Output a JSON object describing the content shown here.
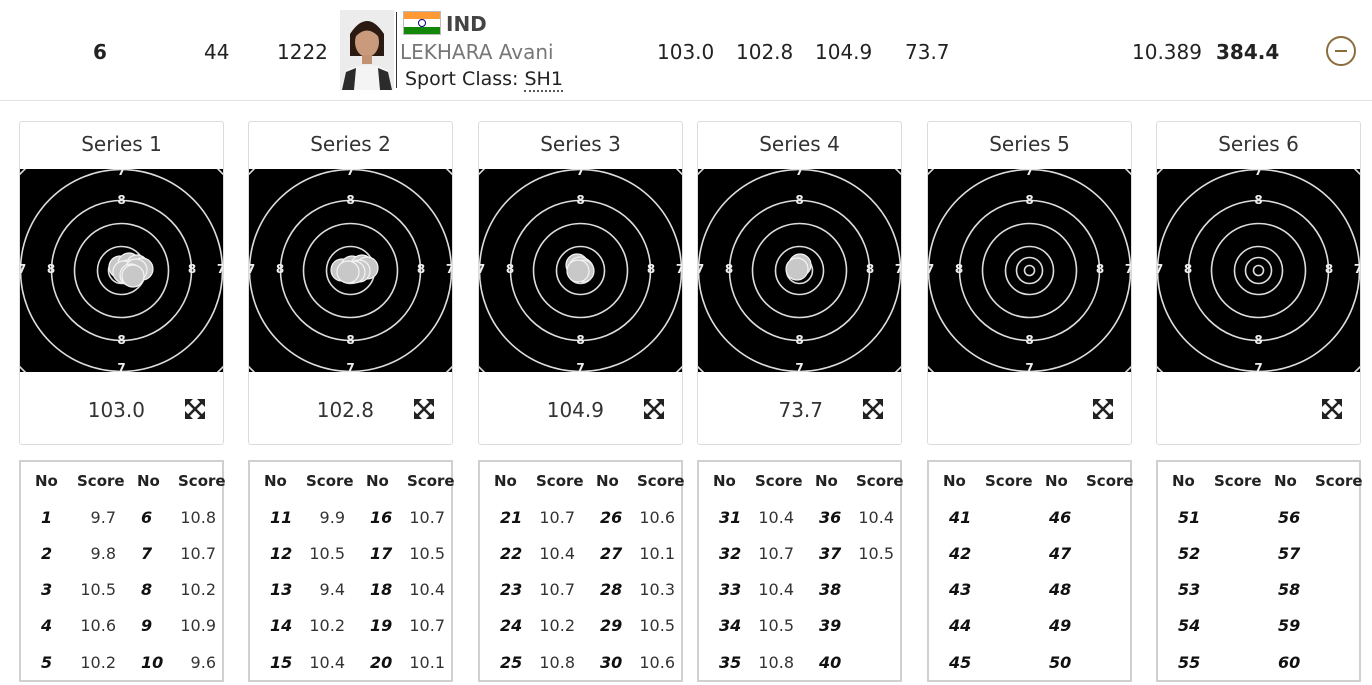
{
  "athlete": {
    "rank": "6",
    "bib": "44",
    "start_no": "1222",
    "noc": "IND",
    "name": "LEKHARA Avani",
    "sport_class_label": "Sport Class:",
    "sport_class": "SH1",
    "series_scores": [
      "103.0",
      "102.8",
      "104.9",
      "73.7"
    ],
    "inner_tens": "10.389",
    "total": "384.4",
    "flag_colors": [
      "#ff9933",
      "#ffffff",
      "#138808"
    ],
    "accent_color": "#8a6d3b"
  },
  "icons": {
    "collapse": "minus-circle-icon",
    "expand": "expand-arrows-icon"
  },
  "series": [
    {
      "title": "Series 1",
      "score": "103.0",
      "shots": [
        {
          "no": "1",
          "score": "9.7"
        },
        {
          "no": "2",
          "score": "9.8"
        },
        {
          "no": "3",
          "score": "10.5"
        },
        {
          "no": "4",
          "score": "10.6"
        },
        {
          "no": "5",
          "score": "10.2"
        },
        {
          "no": "6",
          "score": "10.8"
        },
        {
          "no": "7",
          "score": "10.7"
        },
        {
          "no": "8",
          "score": "10.2"
        },
        {
          "no": "9",
          "score": "10.9"
        },
        {
          "no": "10",
          "score": "9.6"
        }
      ]
    },
    {
      "title": "Series 2",
      "score": "102.8",
      "shots": [
        {
          "no": "11",
          "score": "9.9"
        },
        {
          "no": "12",
          "score": "10.5"
        },
        {
          "no": "13",
          "score": "9.4"
        },
        {
          "no": "14",
          "score": "10.2"
        },
        {
          "no": "15",
          "score": "10.4"
        },
        {
          "no": "16",
          "score": "10.7"
        },
        {
          "no": "17",
          "score": "10.5"
        },
        {
          "no": "18",
          "score": "10.4"
        },
        {
          "no": "19",
          "score": "10.7"
        },
        {
          "no": "20",
          "score": "10.1"
        }
      ]
    },
    {
      "title": "Series 3",
      "score": "104.9",
      "shots": [
        {
          "no": "21",
          "score": "10.7"
        },
        {
          "no": "22",
          "score": "10.4"
        },
        {
          "no": "23",
          "score": "10.7"
        },
        {
          "no": "24",
          "score": "10.2"
        },
        {
          "no": "25",
          "score": "10.8"
        },
        {
          "no": "26",
          "score": "10.6"
        },
        {
          "no": "27",
          "score": "10.1"
        },
        {
          "no": "28",
          "score": "10.3"
        },
        {
          "no": "29",
          "score": "10.5"
        },
        {
          "no": "30",
          "score": "10.6"
        }
      ]
    },
    {
      "title": "Series 4",
      "score": "73.7",
      "shots": [
        {
          "no": "31",
          "score": "10.4"
        },
        {
          "no": "32",
          "score": "10.7"
        },
        {
          "no": "33",
          "score": "10.4"
        },
        {
          "no": "34",
          "score": "10.5"
        },
        {
          "no": "35",
          "score": "10.8"
        },
        {
          "no": "36",
          "score": "10.4"
        },
        {
          "no": "37",
          "score": "10.5"
        },
        {
          "no": "38",
          "score": ""
        },
        {
          "no": "39",
          "score": ""
        },
        {
          "no": "40",
          "score": ""
        }
      ]
    },
    {
      "title": "Series 5",
      "score": "",
      "shots": [
        {
          "no": "41",
          "score": ""
        },
        {
          "no": "42",
          "score": ""
        },
        {
          "no": "43",
          "score": ""
        },
        {
          "no": "44",
          "score": ""
        },
        {
          "no": "45",
          "score": ""
        },
        {
          "no": "46",
          "score": ""
        },
        {
          "no": "47",
          "score": ""
        },
        {
          "no": "48",
          "score": ""
        },
        {
          "no": "49",
          "score": ""
        },
        {
          "no": "50",
          "score": ""
        }
      ]
    },
    {
      "title": "Series 6",
      "score": "",
      "shots": [
        {
          "no": "51",
          "score": ""
        },
        {
          "no": "52",
          "score": ""
        },
        {
          "no": "53",
          "score": ""
        },
        {
          "no": "54",
          "score": ""
        },
        {
          "no": "55",
          "score": ""
        },
        {
          "no": "56",
          "score": ""
        },
        {
          "no": "57",
          "score": ""
        },
        {
          "no": "58",
          "score": ""
        },
        {
          "no": "59",
          "score": ""
        },
        {
          "no": "60",
          "score": ""
        }
      ]
    }
  ],
  "table_headers": {
    "no": "No",
    "score": "Score"
  },
  "target_ring_labels": {
    "outer": "7",
    "inner": "8"
  }
}
